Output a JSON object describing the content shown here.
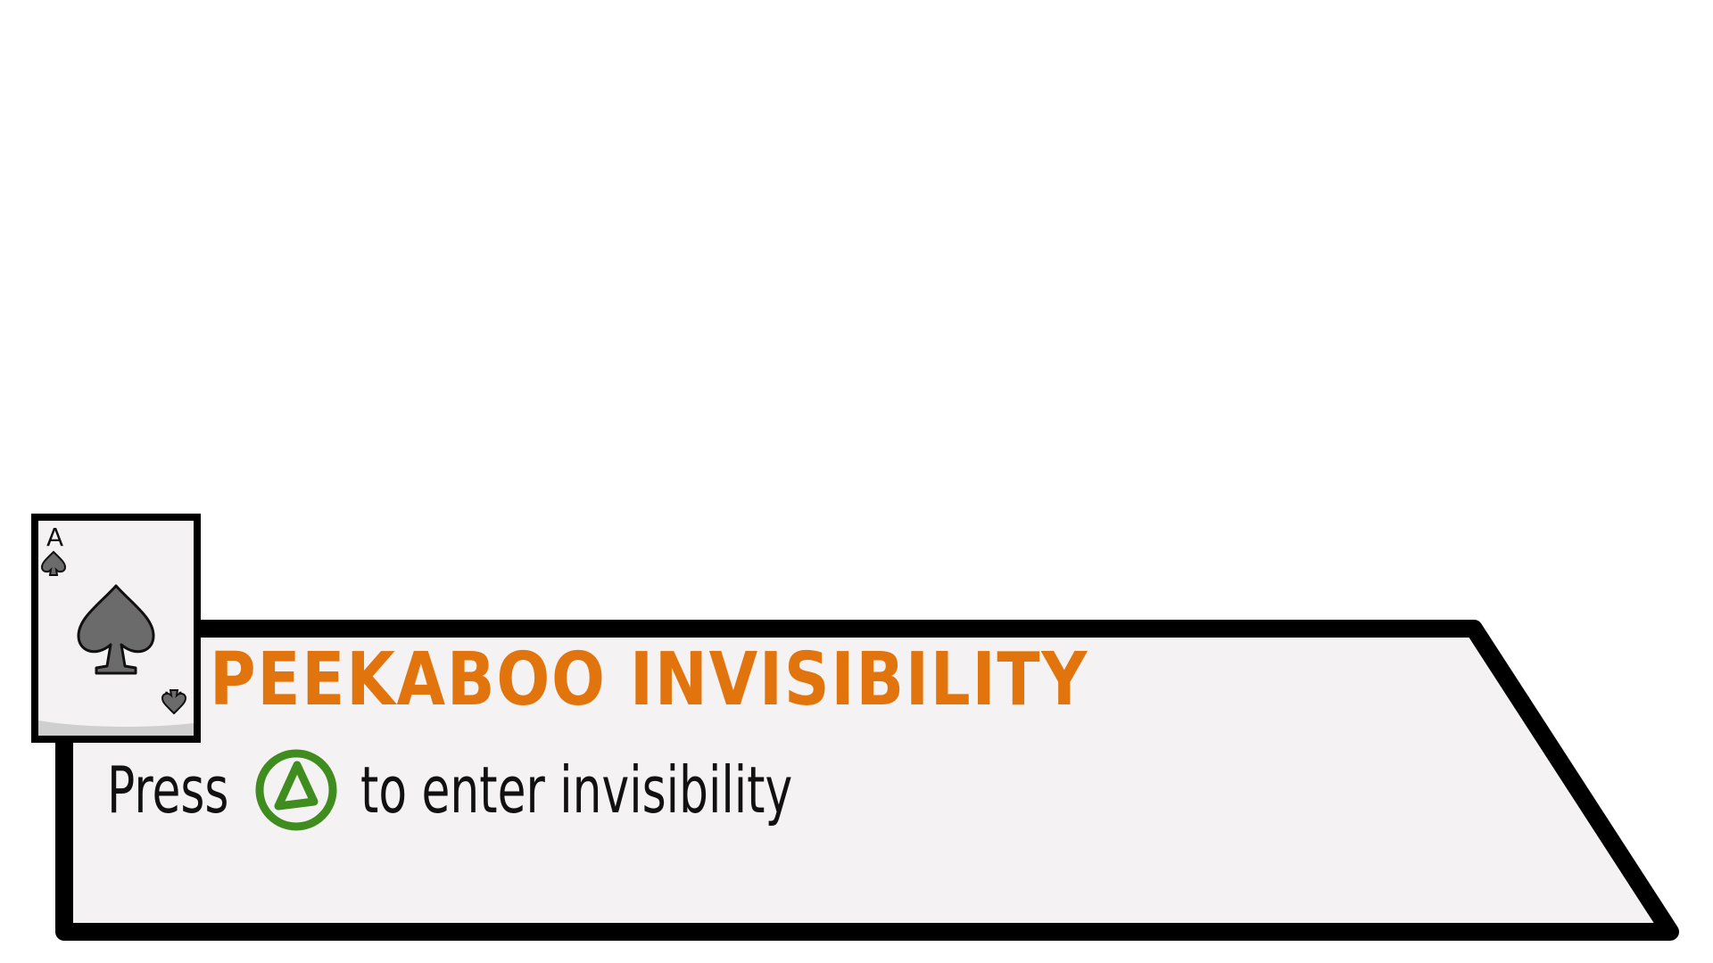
{
  "ability": {
    "name": "Peekaboo Invisibility",
    "prompt_before": "Press",
    "prompt_after": "to enter invisibility",
    "button_icon": "triangle-button-icon"
  },
  "card": {
    "rank": "A",
    "suit": "spade"
  },
  "colors": {
    "title": "#e2740d",
    "button_ring": "#3f8d1f",
    "panel_fill": "#f4f2f3",
    "outline": "#000000",
    "suit": "#6b6b6b"
  }
}
